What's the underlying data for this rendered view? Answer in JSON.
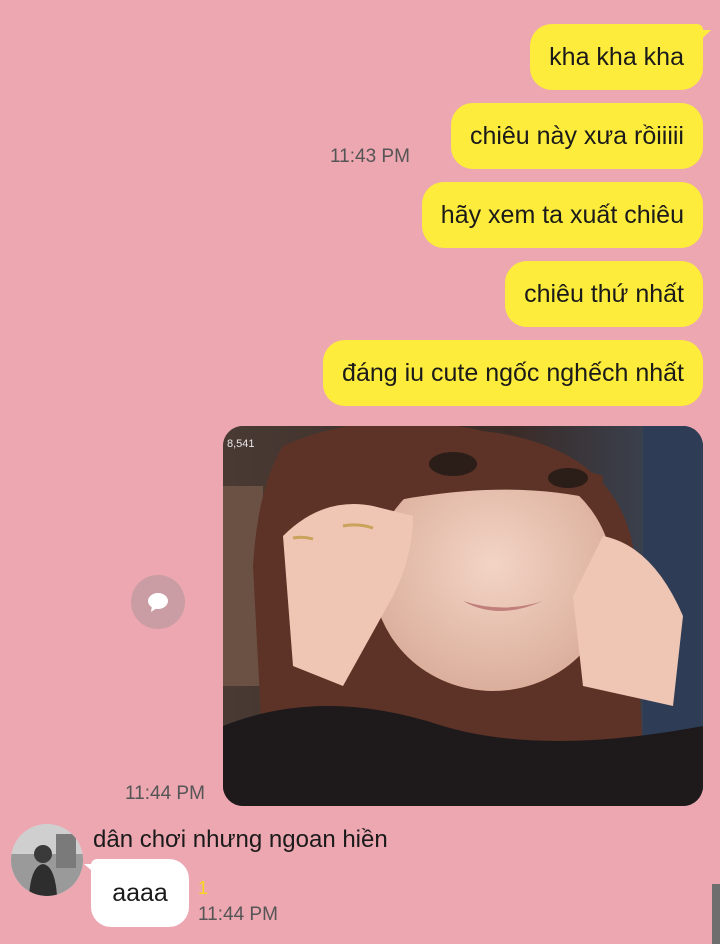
{
  "outgoing_messages": [
    {
      "text": "kha kha kha"
    },
    {
      "text": "chiêu này xưa rồiiiii",
      "time": "11:43 PM"
    },
    {
      "text": "hãy xem ta xuất chiêu"
    },
    {
      "text": "chiêu thứ nhất"
    },
    {
      "text": "đáng iu cute ngốc nghếch nhất"
    }
  ],
  "photo_message": {
    "counter": "8,541",
    "time": "11:44 PM",
    "icon": "speech-bubble-icon"
  },
  "incoming_message": {
    "sender": "dân chơi nhưng ngoan hiền",
    "text": "aaaa",
    "unread_count": "1",
    "time": "11:44 PM"
  },
  "colors": {
    "background": "#eca7b1",
    "outgoing_bubble": "#fdec3b",
    "incoming_bubble": "#ffffff",
    "unread": "#f5d91a"
  }
}
